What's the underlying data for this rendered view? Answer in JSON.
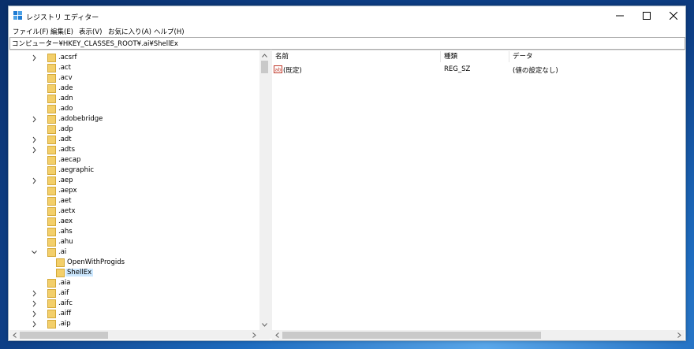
{
  "window": {
    "title": "レジストリ エディター",
    "controls": {
      "minimize": "—",
      "maximize": "☐",
      "close": "✕"
    }
  },
  "menu": [
    "ファイル(F)",
    "編集(E)",
    "表示(V)",
    "お気に入り(A)",
    "ヘルプ(H)"
  ],
  "address": "コンピューター¥HKEY_CLASSES_ROOT¥.ai¥ShellEx",
  "tree": [
    {
      "label": ".acsrf",
      "expander": "collapsed",
      "indent": 0
    },
    {
      "label": ".act",
      "expander": "none",
      "indent": 0
    },
    {
      "label": ".acv",
      "expander": "none",
      "indent": 0
    },
    {
      "label": ".ade",
      "expander": "none",
      "indent": 0
    },
    {
      "label": ".adn",
      "expander": "none",
      "indent": 0
    },
    {
      "label": ".ado",
      "expander": "none",
      "indent": 0
    },
    {
      "label": ".adobebridge",
      "expander": "collapsed",
      "indent": 0
    },
    {
      "label": ".adp",
      "expander": "none",
      "indent": 0
    },
    {
      "label": ".adt",
      "expander": "collapsed",
      "indent": 0
    },
    {
      "label": ".adts",
      "expander": "collapsed",
      "indent": 0
    },
    {
      "label": ".aecap",
      "expander": "none",
      "indent": 0
    },
    {
      "label": ".aegraphic",
      "expander": "none",
      "indent": 0
    },
    {
      "label": ".aep",
      "expander": "collapsed",
      "indent": 0
    },
    {
      "label": ".aepx",
      "expander": "none",
      "indent": 0
    },
    {
      "label": ".aet",
      "expander": "none",
      "indent": 0
    },
    {
      "label": ".aetx",
      "expander": "none",
      "indent": 0
    },
    {
      "label": ".aex",
      "expander": "none",
      "indent": 0
    },
    {
      "label": ".ahs",
      "expander": "none",
      "indent": 0
    },
    {
      "label": ".ahu",
      "expander": "none",
      "indent": 0
    },
    {
      "label": ".ai",
      "expander": "expanded",
      "indent": 0
    },
    {
      "label": "OpenWithProgids",
      "expander": "none",
      "indent": 1
    },
    {
      "label": "ShellEx",
      "expander": "none",
      "indent": 1,
      "selected": true
    },
    {
      "label": ".aia",
      "expander": "none",
      "indent": 0
    },
    {
      "label": ".aif",
      "expander": "collapsed",
      "indent": 0
    },
    {
      "label": ".aifc",
      "expander": "collapsed",
      "indent": 0
    },
    {
      "label": ".aiff",
      "expander": "collapsed",
      "indent": 0
    },
    {
      "label": ".aip",
      "expander": "collapsed",
      "indent": 0
    }
  ],
  "list": {
    "columns": [
      "名前",
      "種類",
      "データ"
    ],
    "rows": [
      {
        "icon": "string-value-icon",
        "name": "(既定)",
        "type": "REG_SZ",
        "data": "(値の設定なし)"
      }
    ]
  },
  "colors": {
    "selection": "#cce8ff",
    "folder": "#f3cf6a",
    "accent": "#0078d7"
  }
}
